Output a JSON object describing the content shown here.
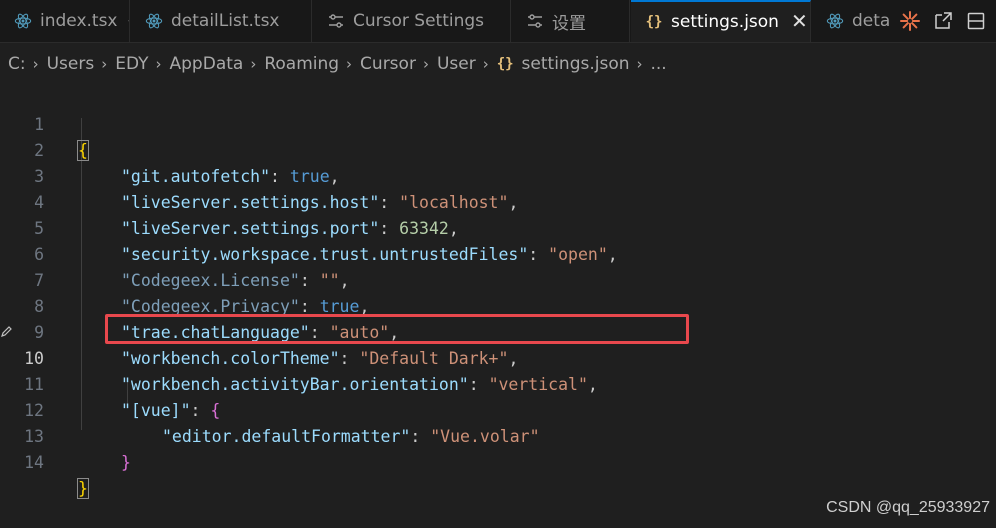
{
  "tabs": [
    {
      "label": "index.tsx",
      "icon": "react-icon",
      "pinned": true
    },
    {
      "label": "detailList.tsx",
      "icon": "react-icon"
    },
    {
      "label": "Cursor Settings",
      "icon": "settings-sliders-icon"
    },
    {
      "label": "设置",
      "icon": "settings-sliders-icon"
    },
    {
      "label": "settings.json",
      "icon": "json-braces-icon",
      "active": true,
      "close": "✕"
    },
    {
      "label": "deta",
      "icon": "react-icon"
    }
  ],
  "tab_icons": {
    "braces": "{}"
  },
  "breadcrumb": {
    "items": [
      "C:",
      "Users",
      "EDY",
      "AppData",
      "Roaming",
      "Cursor",
      "User",
      "settings.json",
      "..."
    ],
    "file_icon": "{}"
  },
  "editor": {
    "line_numbers": [
      "1",
      "2",
      "3",
      "4",
      "5",
      "6",
      "7",
      "8",
      "9",
      "10",
      "11",
      "12",
      "13",
      "14"
    ],
    "current_line": 10,
    "lines": [
      {
        "open": "{"
      },
      {
        "key": "\"git.autofetch\"",
        "value": "true",
        "vtype": "bool"
      },
      {
        "key": "\"liveServer.settings.host\"",
        "value": "\"localhost\"",
        "vtype": "string"
      },
      {
        "key": "\"liveServer.settings.port\"",
        "value": "63342",
        "vtype": "number"
      },
      {
        "key": "\"security.workspace.trust.untrustedFiles\"",
        "value": "\"open\"",
        "vtype": "string"
      },
      {
        "key": "\"Codegeex.License\"",
        "value": "\"\"",
        "vtype": "string",
        "dim": true
      },
      {
        "key": "\"Codegeex.Privacy\"",
        "value": "true",
        "vtype": "bool",
        "dim": true
      },
      {
        "key": "\"trae.chatLanguage\"",
        "value": "\"auto\"",
        "vtype": "string"
      },
      {
        "key": "\"workbench.colorTheme\"",
        "value": "\"Default Dark+\"",
        "vtype": "string"
      },
      {
        "key": "\"workbench.activityBar.orientation\"",
        "value": "\"vertical\"",
        "vtype": "string"
      },
      {
        "key": "\"[vue]\"",
        "value": "{",
        "vtype": "brace"
      },
      {
        "key": "\"editor.defaultFormatter\"",
        "value": "\"Vue.volar\"",
        "vtype": "string"
      },
      {
        "close": "}"
      },
      {
        "close": "}"
      }
    ],
    "punct": {
      "colon": ": ",
      "comma": ","
    }
  },
  "colors": {
    "highlight_box": "#e8484d",
    "accent": "#0078d4"
  },
  "watermark": "CSDN @qq_25933927"
}
